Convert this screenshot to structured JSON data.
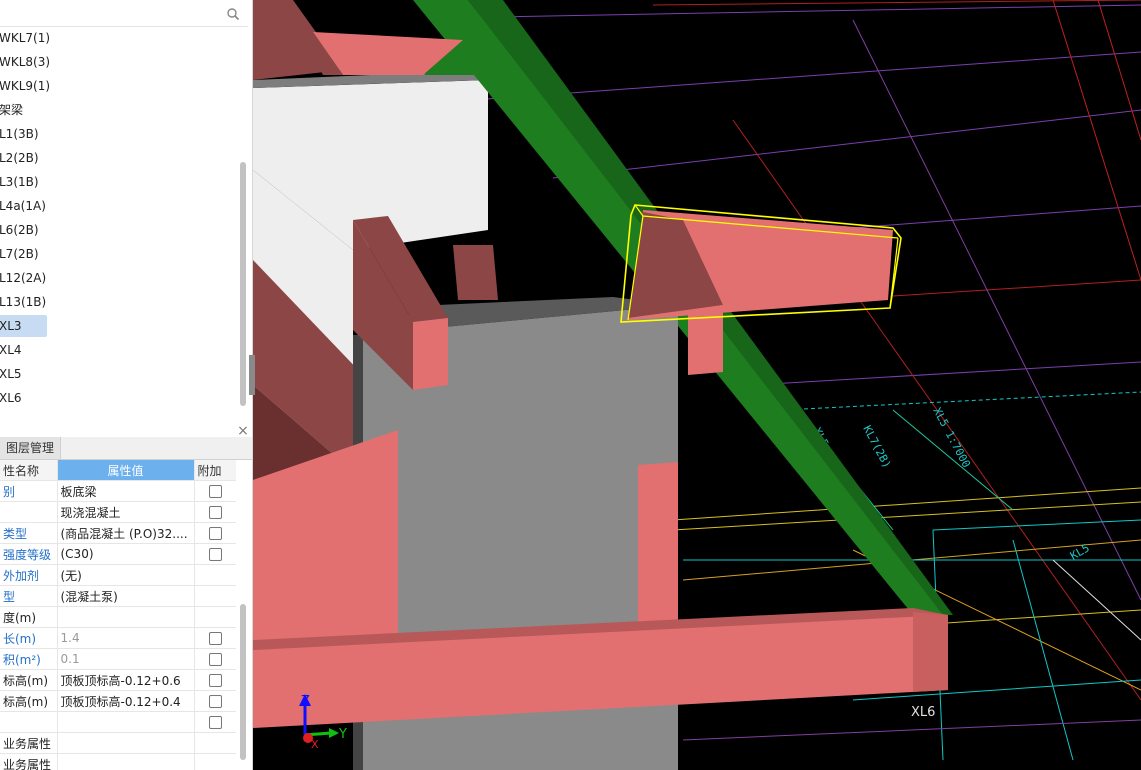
{
  "tree": {
    "items": [
      {
        "label": "WKL7(1)"
      },
      {
        "label": "WKL8(3)"
      },
      {
        "label": "WKL9(1)"
      },
      {
        "label": "架梁"
      },
      {
        "label": "L1(3B)"
      },
      {
        "label": "L2(2B)"
      },
      {
        "label": "L3(1B)"
      },
      {
        "label": "L4a(1A)"
      },
      {
        "label": "L6(2B)"
      },
      {
        "label": "L7(2B)"
      },
      {
        "label": "L12(2A)"
      },
      {
        "label": "L13(1B)"
      },
      {
        "label": "XL3",
        "selected": true
      },
      {
        "label": "XL4"
      },
      {
        "label": "XL5"
      },
      {
        "label": "XL6"
      }
    ]
  },
  "panel": {
    "tab_layers": "图层管理",
    "close_glyph": "×"
  },
  "props": {
    "headers": {
      "name": "性名称",
      "value": "属性值",
      "extra": "附加"
    },
    "rows": [
      {
        "name": "别",
        "value": "板底梁",
        "blue": true,
        "checkbox": true
      },
      {
        "name": "",
        "value": "现浇混凝土",
        "blue": false,
        "checkbox": true
      },
      {
        "name": "类型",
        "value": "(商品混凝土 (P.O)32....",
        "blue": true,
        "checkbox": true
      },
      {
        "name": "强度等级",
        "value": "(C30)",
        "blue": true,
        "checkbox": true
      },
      {
        "name": "外加剂",
        "value": "(无)",
        "blue": true,
        "checkbox": false
      },
      {
        "name": "型",
        "value": "(混凝土泵)",
        "blue": true,
        "checkbox": false
      },
      {
        "name": "度(m)",
        "value": "",
        "blue": false,
        "checkbox": false
      },
      {
        "name": "长(m)",
        "value": "1.4",
        "blue": true,
        "checkbox": true,
        "gray": true
      },
      {
        "name": "积(m²)",
        "value": "0.1",
        "blue": true,
        "checkbox": true,
        "gray": true
      },
      {
        "name": "标高(m)",
        "value": "顶板顶标高-0.12+0.6",
        "blue": false,
        "checkbox": true
      },
      {
        "name": "标高(m)",
        "value": "顶板顶标高-0.12+0.4",
        "blue": false,
        "checkbox": true
      },
      {
        "name": "",
        "value": "",
        "blue": false,
        "checkbox": true
      },
      {
        "name": "业务属性",
        "value": "",
        "blue": false,
        "checkbox": false
      },
      {
        "name": "业务属性",
        "value": "",
        "blue": false,
        "checkbox": false
      }
    ]
  },
  "viewport": {
    "axis_z": "Z",
    "axis_y": "Y",
    "axis_x": "X",
    "cad_label_xl6": "XL6",
    "colors": {
      "background": "#000000",
      "beam_pink": "#e27070",
      "beam_dark": "#8c4646",
      "green_beam": "#1e7d1e",
      "column_gray": "#8a8a8a",
      "wall_white": "#eeeeee",
      "selection": "#ffff00"
    }
  }
}
